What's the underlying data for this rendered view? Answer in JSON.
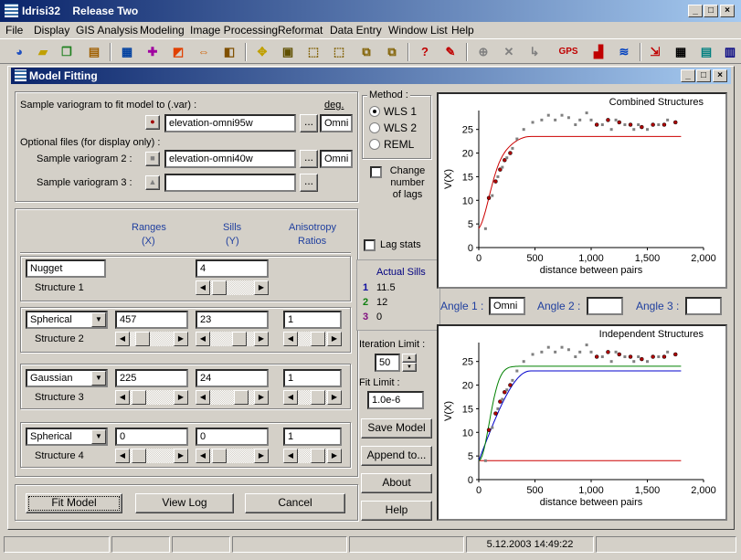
{
  "app": {
    "title": "Idrisi32",
    "release": "Release Two"
  },
  "menu": [
    "File",
    "Display",
    "GIS Analysis",
    "Modeling",
    "Image Processing",
    "Reformat",
    "Data Entry",
    "Window List",
    "Help"
  ],
  "toolbar": {
    "gps": "GPS"
  },
  "dialog": {
    "title": "Model Fitting"
  },
  "files": {
    "sample_label": "Sample variogram to fit model to (.var) :",
    "deg_label": "deg.",
    "var1": "elevation-omni95w",
    "var1_deg": "Omni",
    "optional_label": "Optional files (for display only) :",
    "var2_label": "Sample variogram 2 :",
    "var2": "elevation-omni40w",
    "var2_deg": "Omni",
    "var3_label": "Sample variogram 3 :",
    "var3": "",
    "browse": "..."
  },
  "method": {
    "title": "Method :",
    "options": [
      "WLS 1",
      "WLS 2",
      "REML"
    ],
    "selected": 0,
    "change_lags": "Change number of lags",
    "lag_stats": "Lag stats"
  },
  "headers": {
    "ranges": "Ranges",
    "ranges_unit": "(X)",
    "sills": "Sills",
    "sills_unit": "(Y)",
    "aniso": "Anisotropy",
    "aniso_unit": "Ratios"
  },
  "structures": [
    {
      "type": "Nugget",
      "label": "Structure 1",
      "range": "",
      "sill": "4",
      "aniso": ""
    },
    {
      "type": "Spherical",
      "label": "Structure 2",
      "range": "457",
      "sill": "23",
      "aniso": "1"
    },
    {
      "type": "Gaussian",
      "label": "Structure 3",
      "range": "225",
      "sill": "24",
      "aniso": "1"
    },
    {
      "type": "Spherical",
      "label": "Structure 4",
      "range": "0",
      "sill": "0",
      "aniso": "1"
    }
  ],
  "actual_sills": {
    "title": "Actual Sills",
    "rows": [
      {
        "n": "1",
        "v": "11.5",
        "color": "#1010a0"
      },
      {
        "n": "2",
        "v": "12",
        "color": "#108010"
      },
      {
        "n": "3",
        "v": "0",
        "color": "#801080"
      }
    ]
  },
  "iteration": {
    "label": "Iteration Limit :",
    "value": "50"
  },
  "fit": {
    "label": "Fit Limit :",
    "value": "1.0e-6"
  },
  "buttons": {
    "save": "Save Model",
    "append": "Append to...",
    "about": "About",
    "help": "Help",
    "fit": "Fit Model",
    "viewlog": "View Log",
    "cancel": "Cancel"
  },
  "angles": {
    "a1": "Angle 1 :",
    "a1v": "Omni",
    "a2": "Angle 2 :",
    "a2v": "",
    "a3": "Angle 3 :",
    "a3v": ""
  },
  "status": {
    "datetime": "5.12.2003 14:49:22"
  },
  "chart_data": [
    {
      "type": "scatter",
      "title": "Combined Structures",
      "xlabel": "distance between pairs",
      "ylabel": "V(X)",
      "xlim": [
        0,
        2000
      ],
      "ylim": [
        0,
        29
      ],
      "xticks": [
        "0",
        "500",
        "1,000",
        "1,500",
        "2,000"
      ],
      "yticks": [
        "0",
        "5",
        "10",
        "15",
        "20",
        "25"
      ],
      "series": [
        {
          "color": "#b00000",
          "points": [
            [
              90,
              10.5
            ],
            [
              150,
              14
            ],
            [
              190,
              16.5
            ],
            [
              230,
              18.5
            ],
            [
              280,
              20
            ],
            [
              1050,
              26
            ],
            [
              1150,
              27
            ],
            [
              1250,
              26.5
            ],
            [
              1350,
              26
            ],
            [
              1450,
              25.5
            ],
            [
              1550,
              26
            ],
            [
              1650,
              26
            ],
            [
              1750,
              26.5
            ]
          ]
        },
        {
          "color": "#808080",
          "points": [
            [
              60,
              4
            ],
            [
              120,
              11
            ],
            [
              170,
              15
            ],
            [
              210,
              17
            ],
            [
              250,
              19
            ],
            [
              300,
              21
            ],
            [
              340,
              23
            ],
            [
              400,
              25
            ],
            [
              480,
              26.5
            ],
            [
              560,
              27
            ],
            [
              620,
              28
            ],
            [
              680,
              27
            ],
            [
              740,
              28
            ],
            [
              800,
              27.5
            ],
            [
              860,
              26
            ],
            [
              900,
              27
            ],
            [
              960,
              28.5
            ],
            [
              1000,
              27
            ],
            [
              1100,
              26
            ],
            [
              1180,
              25
            ],
            [
              1220,
              27
            ],
            [
              1300,
              26
            ],
            [
              1380,
              25
            ],
            [
              1420,
              26
            ],
            [
              1500,
              25
            ],
            [
              1600,
              26
            ],
            [
              1680,
              27
            ]
          ]
        }
      ],
      "curves": [
        {
          "color": "#cc0000",
          "model": "combined"
        }
      ]
    },
    {
      "type": "scatter",
      "title": "Independent Structures",
      "xlabel": "distance between pairs",
      "ylabel": "V(X)",
      "xlim": [
        0,
        2000
      ],
      "ylim": [
        0,
        29
      ],
      "xticks": [
        "0",
        "500",
        "1,000",
        "1,500",
        "2,000"
      ],
      "yticks": [
        "0",
        "5",
        "10",
        "15",
        "20",
        "25"
      ],
      "series": [
        {
          "color": "#b00000",
          "points": [
            [
              90,
              10.5
            ],
            [
              150,
              14
            ],
            [
              190,
              16.5
            ],
            [
              230,
              18.5
            ],
            [
              280,
              20
            ],
            [
              1050,
              26
            ],
            [
              1150,
              27
            ],
            [
              1250,
              26.5
            ],
            [
              1350,
              26
            ],
            [
              1450,
              25.5
            ],
            [
              1550,
              26
            ],
            [
              1650,
              26
            ],
            [
              1750,
              26.5
            ]
          ]
        },
        {
          "color": "#808080",
          "points": [
            [
              60,
              4
            ],
            [
              120,
              11
            ],
            [
              170,
              15
            ],
            [
              210,
              17
            ],
            [
              250,
              19
            ],
            [
              300,
              21
            ],
            [
              340,
              23
            ],
            [
              400,
              25
            ],
            [
              480,
              26.5
            ],
            [
              560,
              27
            ],
            [
              620,
              28
            ],
            [
              680,
              27
            ],
            [
              740,
              28
            ],
            [
              800,
              27.5
            ],
            [
              860,
              26
            ],
            [
              900,
              27
            ],
            [
              960,
              28.5
            ],
            [
              1000,
              27
            ],
            [
              1100,
              26
            ],
            [
              1180,
              25
            ],
            [
              1220,
              27
            ],
            [
              1300,
              26
            ],
            [
              1380,
              25
            ],
            [
              1420,
              26
            ],
            [
              1500,
              25
            ],
            [
              1600,
              26
            ],
            [
              1680,
              27
            ]
          ]
        }
      ],
      "curves": [
        {
          "color": "#cc0000",
          "model": "nugget"
        },
        {
          "color": "#0000cc",
          "model": "spherical"
        },
        {
          "color": "#008000",
          "model": "gaussian"
        }
      ]
    }
  ]
}
